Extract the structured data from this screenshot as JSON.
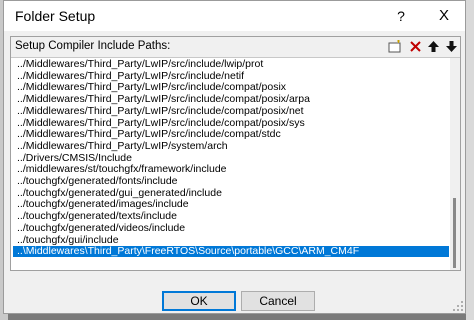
{
  "dialog": {
    "title": "Folder Setup",
    "help_label": "?",
    "close_label": "X"
  },
  "panel": {
    "label": "Setup Compiler Include Paths:",
    "toolbar": [
      {
        "name": "new-folder-icon",
        "glyph": "▭"
      },
      {
        "name": "delete-icon",
        "glyph": "✕"
      },
      {
        "name": "move-up-icon",
        "glyph": "▲"
      },
      {
        "name": "move-down-icon",
        "glyph": "▼"
      }
    ],
    "paths": [
      "../Middlewares/Third_Party/LwIP/src/include/lwip/prot",
      "../Middlewares/Third_Party/LwIP/src/include/netif",
      "../Middlewares/Third_Party/LwIP/src/include/compat/posix",
      "../Middlewares/Third_Party/LwIP/src/include/compat/posix/arpa",
      "../Middlewares/Third_Party/LwIP/src/include/compat/posix/net",
      "../Middlewares/Third_Party/LwIP/src/include/compat/posix/sys",
      "../Middlewares/Third_Party/LwIP/src/include/compat/stdc",
      "../Middlewares/Third_Party/LwIP/system/arch",
      "../Drivers/CMSIS/Include",
      "../middlewares/st/touchgfx/framework/include",
      "../touchgfx/generated/fonts/include",
      "../touchgfx/generated/gui_generated/include",
      "../touchgfx/generated/images/include",
      "../touchgfx/generated/texts/include",
      "../touchgfx/generated/videos/include",
      "../touchgfx/gui/include",
      "..\\Middlewares\\Third_Party\\FreeRTOS\\Source\\portable\\GCC\\ARM_CM4F"
    ],
    "selected_index": 16
  },
  "buttons": {
    "ok": "OK",
    "cancel": "Cancel"
  },
  "colors": {
    "selection": "#0078d7",
    "delete": "#c00000"
  }
}
